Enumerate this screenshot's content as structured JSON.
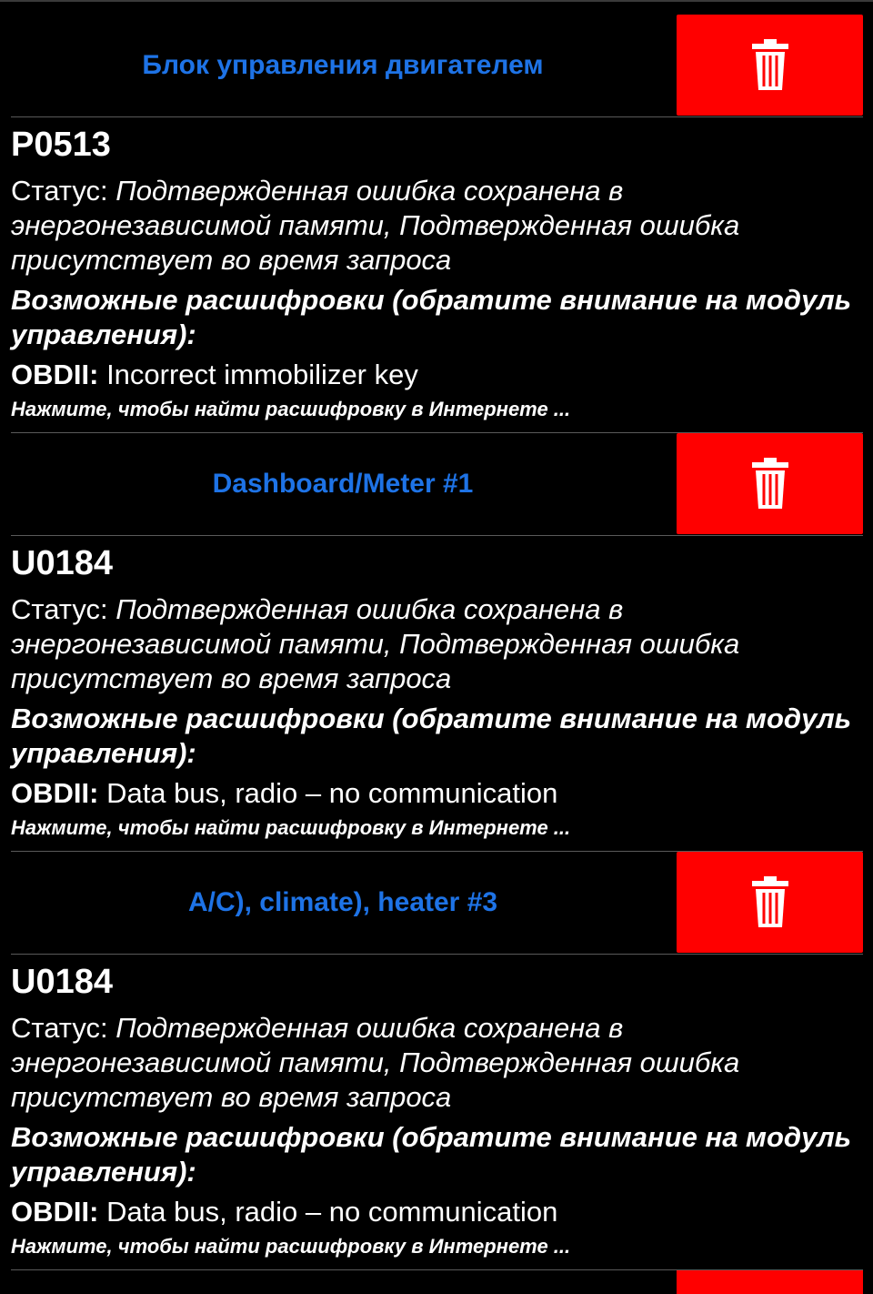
{
  "entries": [
    {
      "module": "Блок управления двигателем",
      "code": "P0513",
      "status_label": "Статус:",
      "status_value": "Подтвержденная ошибка сохранена в энергонезависимой памяти, Подтвержденная ошибка присутствует во время запроса",
      "decode_title": "Возможные расшифровки (обратите внимание на модуль управления):",
      "obd_label": "OBDII:",
      "obd_value": "Incorrect immobilizer key",
      "search_link": "Нажмите, чтобы найти расшифровку в Интернете ..."
    },
    {
      "module": "Dashboard/Meter #1",
      "code": "U0184",
      "status_label": "Статус:",
      "status_value": "Подтвержденная ошибка сохранена в энергонезависимой памяти, Подтвержденная ошибка присутствует во время запроса",
      "decode_title": "Возможные расшифровки (обратите внимание на модуль управления):",
      "obd_label": "OBDII:",
      "obd_value": "Data bus, radio – no communication",
      "search_link": "Нажмите, чтобы найти расшифровку в Интернете ..."
    },
    {
      "module": "A/C), climate), heater #3",
      "code": "U0184",
      "status_label": "Статус:",
      "status_value": "Подтвержденная ошибка сохранена в энергонезависимой памяти, Подтвержденная ошибка присутствует во время запроса",
      "decode_title": "Возможные расшифровки (обратите внимание на модуль управления):",
      "obd_label": "OBDII:",
      "obd_value": "Data bus, radio – no communication",
      "search_link": "Нажмите, чтобы найти расшифровку в Интернете ..."
    }
  ],
  "icons": {
    "delete": "trash-icon"
  },
  "colors": {
    "background": "#000000",
    "module_title": "#1e73e6",
    "delete_button": "#ff0000",
    "text": "#ffffff",
    "divider": "#5a5a5a"
  }
}
